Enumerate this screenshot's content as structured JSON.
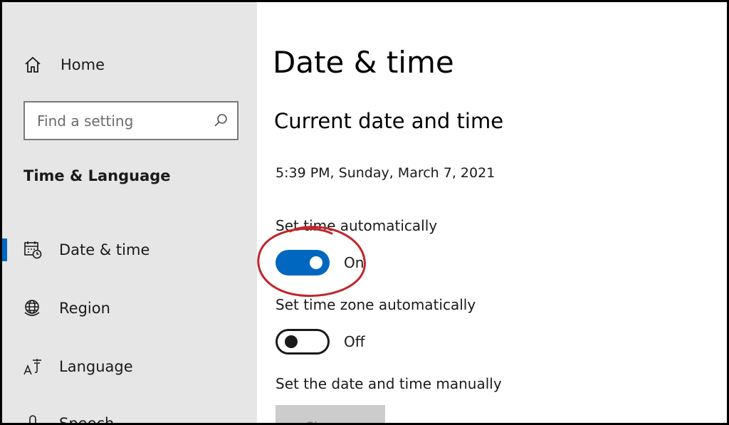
{
  "sidebar": {
    "home_label": "Home",
    "search_placeholder": "Find a setting",
    "section_title": "Time & Language",
    "items": [
      {
        "label": "Date & time",
        "icon": "calendar-clock-icon",
        "active": true
      },
      {
        "label": "Region",
        "icon": "globe-icon",
        "active": false
      },
      {
        "label": "Language",
        "icon": "language-icon",
        "active": false
      },
      {
        "label": "Speech",
        "icon": "microphone-icon",
        "active": false
      }
    ]
  },
  "main": {
    "page_title": "Date & time",
    "section_title": "Current date and time",
    "current_datetime": "5:39 PM, Sunday, March 7, 2021",
    "set_time_auto": {
      "label": "Set time automatically",
      "state": "On",
      "on": true
    },
    "set_zone_auto": {
      "label": "Set time zone automatically",
      "state": "Off",
      "on": false
    },
    "manual": {
      "label": "Set the date and time manually",
      "button": "Change"
    }
  },
  "colors": {
    "accent": "#0067c0",
    "sidebar_bg": "#e6e6e6",
    "annotation": "#c0262b"
  }
}
